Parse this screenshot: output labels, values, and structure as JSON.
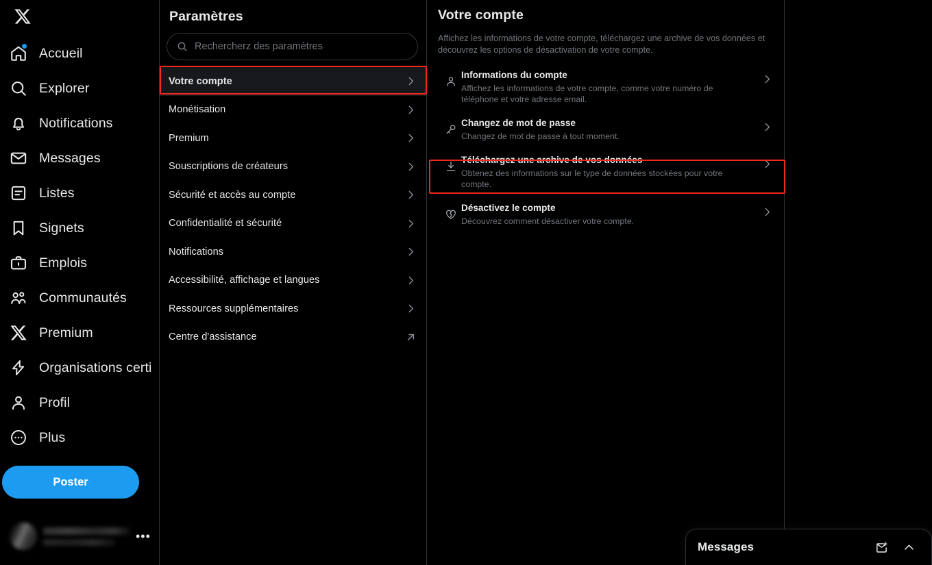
{
  "sidebar": {
    "logo_icon": "x-logo-icon",
    "items": [
      {
        "label": "Accueil",
        "icon": "home-icon",
        "has_badge": true
      },
      {
        "label": "Explorer",
        "icon": "search-icon",
        "has_badge": false
      },
      {
        "label": "Notifications",
        "icon": "bell-icon",
        "has_badge": false
      },
      {
        "label": "Messages",
        "icon": "envelope-icon",
        "has_badge": false
      },
      {
        "label": "Listes",
        "icon": "list-icon",
        "has_badge": false
      },
      {
        "label": "Signets",
        "icon": "bookmark-icon",
        "has_badge": false
      },
      {
        "label": "Emplois",
        "icon": "briefcase-icon",
        "has_badge": false
      },
      {
        "label": "Communautés",
        "icon": "communities-icon",
        "has_badge": false
      },
      {
        "label": "Premium",
        "icon": "x-logo-icon",
        "has_badge": false
      },
      {
        "label": "Organisations certi",
        "icon": "lightning-icon",
        "has_badge": false
      },
      {
        "label": "Profil",
        "icon": "person-icon",
        "has_badge": false
      },
      {
        "label": "Plus",
        "icon": "more-circle-icon",
        "has_badge": false
      }
    ],
    "post_button": "Poster",
    "account_more_icon": "ellipsis-icon"
  },
  "settings": {
    "title": "Paramètres",
    "search": {
      "placeholder": "Rechercherz des paramètres",
      "value": "",
      "icon": "search-icon"
    },
    "items": [
      {
        "label": "Votre compte",
        "selected": true,
        "trailing_icon": "chevron-right-icon"
      },
      {
        "label": "Monétisation",
        "selected": false,
        "trailing_icon": "chevron-right-icon"
      },
      {
        "label": "Premium",
        "selected": false,
        "trailing_icon": "chevron-right-icon"
      },
      {
        "label": "Souscriptions de créateurs",
        "selected": false,
        "trailing_icon": "chevron-right-icon"
      },
      {
        "label": "Sécurité et accès au compte",
        "selected": false,
        "trailing_icon": "chevron-right-icon"
      },
      {
        "label": "Confidentialité et sécurité",
        "selected": false,
        "trailing_icon": "chevron-right-icon"
      },
      {
        "label": "Notifications",
        "selected": false,
        "trailing_icon": "chevron-right-icon"
      },
      {
        "label": "Accessibilité, affichage et langues",
        "selected": false,
        "trailing_icon": "chevron-right-icon"
      },
      {
        "label": "Ressources supplémentaires",
        "selected": false,
        "trailing_icon": "chevron-right-icon"
      },
      {
        "label": "Centre d'assistance",
        "selected": false,
        "trailing_icon": "external-link-icon"
      }
    ]
  },
  "detail": {
    "title": "Votre compte",
    "description": "Affichez les informations de votre compte, téléchargez une archive de vos données et découvrez les options de désactivation de votre compte.",
    "options": [
      {
        "icon": "person-icon",
        "title": "Informations du compte",
        "subtitle": "Affichez les informations de votre compte, comme votre numéro de téléphone et votre adresse email.",
        "trailing_icon": "chevron-right-icon"
      },
      {
        "icon": "key-icon",
        "title": "Changez de mot de passe",
        "subtitle": "Changez de mot de passe à tout moment.",
        "trailing_icon": "chevron-right-icon"
      },
      {
        "icon": "download-icon",
        "title": "Téléchargez une archive de vos données",
        "subtitle": "Obtenez des informations sur le type de données stockées pour votre compte.",
        "trailing_icon": "chevron-right-icon"
      },
      {
        "icon": "broken-heart-icon",
        "title": "Désactivez le compte",
        "subtitle": "Découvrez comment désactiver votre compte.",
        "trailing_icon": "chevron-right-icon"
      }
    ]
  },
  "messages_dock": {
    "title": "Messages",
    "new_message_icon": "new-message-icon",
    "expand_icon": "chevron-up-icon"
  },
  "colors": {
    "background": "#000000",
    "accent_blue": "#1d9bf0",
    "highlight_red": "#f4281c",
    "text_primary": "#e7e9ea",
    "text_secondary": "#71767b",
    "selected_row_bg": "#16181c",
    "divider": "#2f3336"
  }
}
